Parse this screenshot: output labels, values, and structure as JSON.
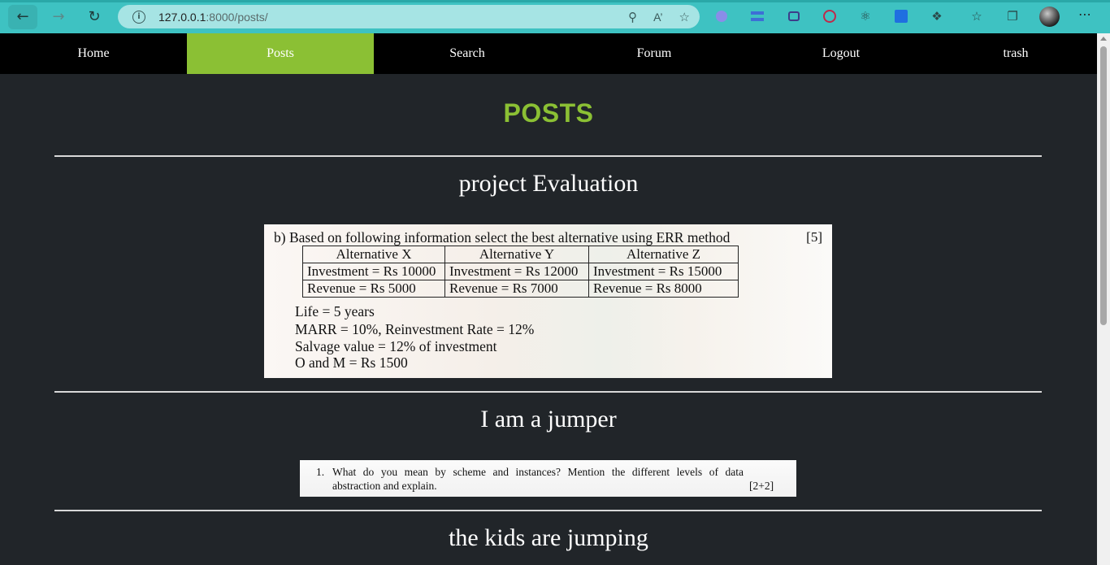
{
  "browser": {
    "url_host": "127.0.0.1",
    "url_rest": ":8000/posts/",
    "icons": [
      "back-icon",
      "forward-icon",
      "reload-icon",
      "info-icon",
      "key-icon",
      "read-aloud-icon",
      "favorite-add-icon",
      "search-extension-icon",
      "extension-icon",
      "extension-icon",
      "record-icon",
      "react-icon",
      "extension-icon",
      "extensions-icon",
      "favorites-icon",
      "collections-icon",
      "profile-avatar",
      "more-icon"
    ]
  },
  "nav": {
    "items": [
      "Home",
      "Posts",
      "Search",
      "Forum",
      "Logout",
      "trash"
    ],
    "active": "Posts",
    "accent": "#8bc034"
  },
  "page": {
    "title": "POSTS"
  },
  "posts": [
    {
      "title": "project Evaluation",
      "image": {
        "question": "b)  Based on following information select the best alternative using ERR method",
        "marks": "[5]",
        "table": {
          "headers": [
            "Alternative X",
            "Alternative Y",
            "Alternative Z"
          ],
          "rows": [
            [
              "Investment = Rs 10000",
              "Investment = Rs 12000",
              "Investment = Rs 15000"
            ],
            [
              "Revenue = Rs 5000",
              "Revenue = Rs 7000",
              "Revenue = Rs 8000"
            ]
          ]
        },
        "info": [
          "Life = 5 years",
          "MARR = 10%, Reinvestment Rate = 12%",
          "Salvage value = 12% of investment",
          "O and M = Rs 1500"
        ]
      }
    },
    {
      "title": "I am a jumper",
      "image": {
        "number": "1.",
        "line1": "What do you mean by scheme and instances? Mention the different levels of data",
        "line2": "abstraction and explain.",
        "marks": "[2+2]"
      }
    },
    {
      "title": "the kids are jumping"
    }
  ]
}
